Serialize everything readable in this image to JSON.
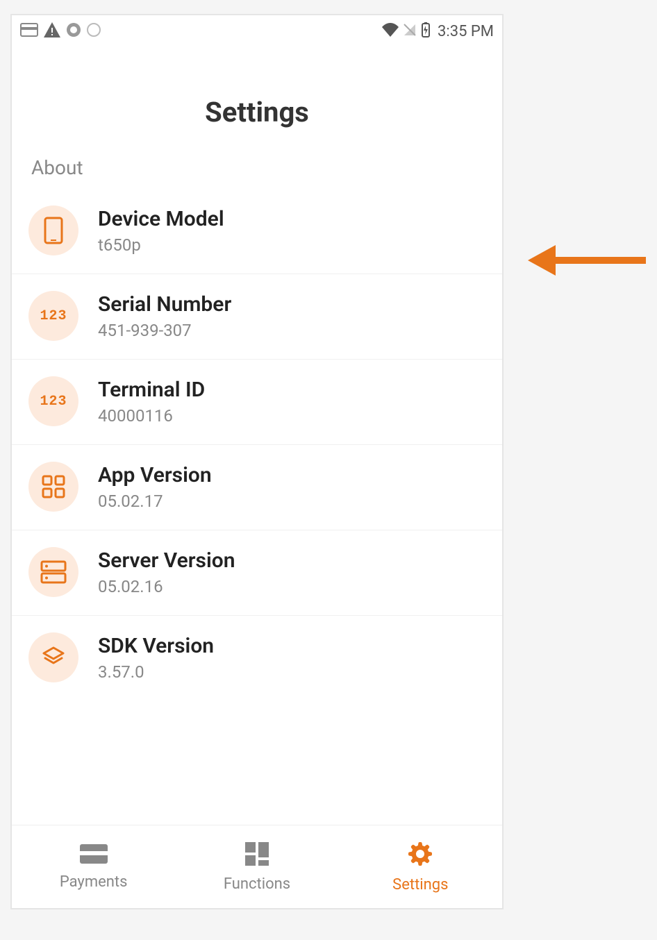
{
  "status": {
    "time": "3:35 PM"
  },
  "page": {
    "title": "Settings",
    "section": "About"
  },
  "about_items": [
    {
      "icon": "device",
      "label": "Device Model",
      "value": "t650p"
    },
    {
      "icon": "123",
      "label": "Serial Number",
      "value": "451-939-307"
    },
    {
      "icon": "123",
      "label": "Terminal ID",
      "value": "40000116"
    },
    {
      "icon": "apps",
      "label": "App Version",
      "value": "05.02.17"
    },
    {
      "icon": "server",
      "label": "Server Version",
      "value": "05.02.16"
    },
    {
      "icon": "layers",
      "label": "SDK Version",
      "value": "3.57.0"
    }
  ],
  "nav": {
    "payments": "Payments",
    "functions": "Functions",
    "settings": "Settings"
  },
  "icon_text": {
    "numeric": "123"
  }
}
